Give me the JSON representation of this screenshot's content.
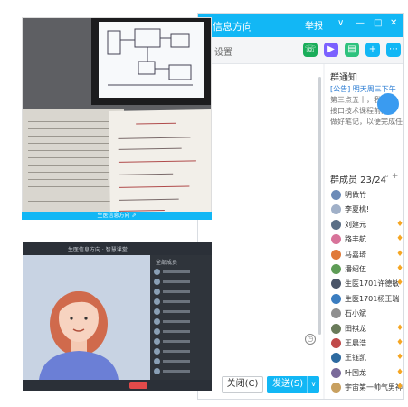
{
  "qq_window": {
    "title": "信息方向",
    "title_buttons": [
      "举报",
      "∨",
      "—",
      "□",
      "✕"
    ],
    "subtitle": "设置",
    "close_label": "关闭(C)",
    "send_label": "发送(S)",
    "send_arrow": "∨",
    "toolbar_icons": [
      "phone-icon",
      "video-icon",
      "file-icon",
      "screen-share-icon",
      "more-icon"
    ],
    "colors": {
      "accent": "#12b7f5",
      "badge": "#f5a623"
    }
  },
  "notice": {
    "title": "群通知",
    "lines": [
      "[公告] 明天周三下午",
      "第三点五十，我们",
      "接口技术课程前面",
      "做好笔记，以便完成任"
    ]
  },
  "members": {
    "header": "群成员 23/24",
    "list": [
      {
        "name": "明做竹",
        "avatar": "#6b8bb8",
        "badge": false
      },
      {
        "name": "李夏桃!",
        "avatar": "#a0b0c8",
        "badge": false
      },
      {
        "name": "刘建元",
        "avatar": "#5b6f86",
        "badge": true
      },
      {
        "name": "路丰航",
        "avatar": "#d8739a",
        "badge": true
      },
      {
        "name": "马嘉琦",
        "avatar": "#e07a3a",
        "badge": true
      },
      {
        "name": "潘绍伍",
        "avatar": "#5e9c56",
        "badge": true
      },
      {
        "name": "生医1701许德敏",
        "avatar": "#4a5568",
        "badge": true
      },
      {
        "name": "生医1701杨王瑞",
        "avatar": "#3b7dc0",
        "badge": false
      },
      {
        "name": "石小斌",
        "avatar": "#8f8f8f",
        "badge": false
      },
      {
        "name": "田祺龙",
        "avatar": "#6a7b5a",
        "badge": true
      },
      {
        "name": "王晨浩",
        "avatar": "#c04a4a",
        "badge": true
      },
      {
        "name": "王钰凯",
        "avatar": "#2d6aa0",
        "badge": true
      },
      {
        "name": "叶国龙",
        "avatar": "#7a6a9a",
        "badge": true
      },
      {
        "name": "宇宙第一帅气男神",
        "avatar": "#c8a060",
        "badge": true
      }
    ]
  },
  "photo": {
    "caption": "生医信息方向 ⇗"
  },
  "video": {
    "title": "生医信息方向 · 智慧课堂",
    "side_label": "全部成员"
  }
}
